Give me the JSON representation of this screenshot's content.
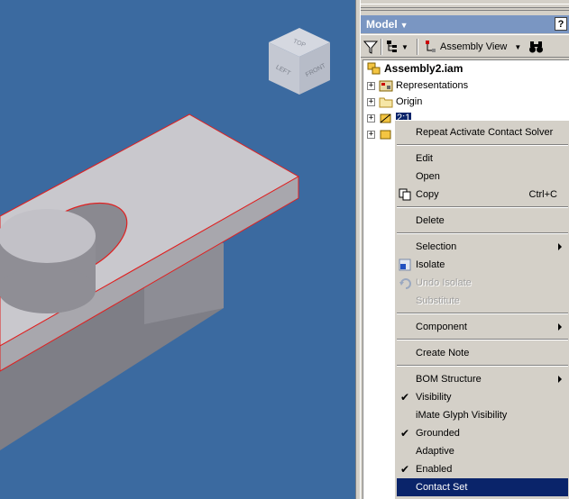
{
  "viewcube": {
    "top": "TOP",
    "left": "LEFT",
    "front": "FRONT"
  },
  "browser": {
    "title": "Model",
    "help": "?",
    "view_label": "Assembly View"
  },
  "tree": {
    "root": "Assembly2.iam",
    "items": [
      {
        "label": "Representations"
      },
      {
        "label": "Origin"
      },
      {
        "label": "2:1"
      },
      {
        "label": ""
      }
    ]
  },
  "context_menu": {
    "repeat": "Repeat Activate Contact Solver",
    "edit": "Edit",
    "open": "Open",
    "copy": "Copy",
    "copy_shortcut": "Ctrl+C",
    "delete": "Delete",
    "selection": "Selection",
    "isolate": "Isolate",
    "undo_isolate": "Undo Isolate",
    "substitute": "Substitute",
    "component": "Component",
    "create_note": "Create Note",
    "bom_structure": "BOM Structure",
    "visibility": "Visibility",
    "imate_glyph": "iMate Glyph Visibility",
    "grounded": "Grounded",
    "adaptive": "Adaptive",
    "enabled": "Enabled",
    "contact_set": "Contact Set"
  },
  "colors": {
    "viewport": "#3b6aa0",
    "highlight": "#0a246a",
    "edge": "#e02020"
  }
}
